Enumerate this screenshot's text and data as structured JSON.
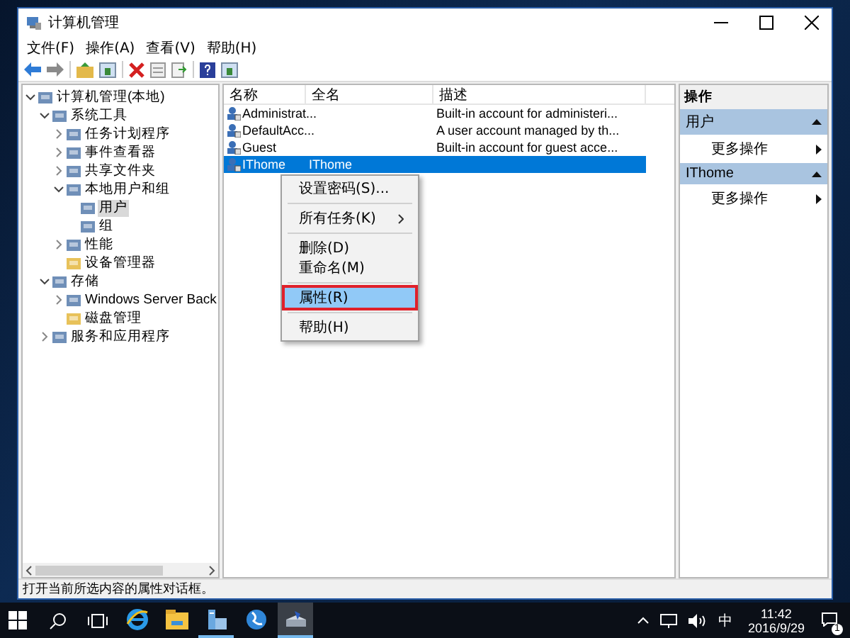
{
  "window": {
    "title": "计算机管理"
  },
  "menu": [
    "文件(F)",
    "操作(A)",
    "查看(V)",
    "帮助(H)"
  ],
  "tree": [
    {
      "label": "计算机管理(本地)",
      "expanded": true,
      "selected": false,
      "children": [
        {
          "label": "系统工具",
          "expanded": true,
          "selected": false,
          "children": [
            {
              "label": "任务计划程序",
              "expanded": false,
              "selected": false
            },
            {
              "label": "事件查看器",
              "expanded": false,
              "selected": false
            },
            {
              "label": "共享文件夹",
              "expanded": false,
              "selected": false
            },
            {
              "label": "本地用户和组",
              "expanded": true,
              "selected": false,
              "children": [
                {
                  "label": "用户",
                  "selected": true
                },
                {
                  "label": "组",
                  "selected": false
                }
              ]
            },
            {
              "label": "性能",
              "expanded": false,
              "selected": false
            },
            {
              "label": "设备管理器",
              "selected": false
            }
          ]
        },
        {
          "label": "存储",
          "expanded": true,
          "selected": false,
          "children": [
            {
              "label": "Windows Server Back",
              "expanded": false,
              "selected": false
            },
            {
              "label": "磁盘管理",
              "selected": false
            }
          ]
        },
        {
          "label": "服务和应用程序",
          "expanded": false,
          "selected": false
        }
      ]
    }
  ],
  "table": {
    "columns": [
      "名称",
      "全名",
      "描述"
    ],
    "rows": [
      {
        "name": "Administrat...",
        "full_name": "",
        "description": "Built-in account for administeri...",
        "selected": false
      },
      {
        "name": "DefaultAcc...",
        "full_name": "",
        "description": "A user account managed by th...",
        "selected": false
      },
      {
        "name": "Guest",
        "full_name": "",
        "description": "Built-in account for guest acce...",
        "selected": false
      },
      {
        "name": "IThome",
        "full_name": "IThome",
        "description": "",
        "selected": true
      }
    ]
  },
  "context_menu": [
    {
      "kind": "item",
      "label": "设置密码(S)...",
      "submenu": false,
      "highlighted": false
    },
    {
      "kind": "separator"
    },
    {
      "kind": "item",
      "label": "所有任务(K)",
      "submenu": true,
      "highlighted": false
    },
    {
      "kind": "separator"
    },
    {
      "kind": "item",
      "label": "删除(D)",
      "submenu": false,
      "highlighted": false
    },
    {
      "kind": "item",
      "label": "重命名(M)",
      "submenu": false,
      "highlighted": false
    },
    {
      "kind": "separator"
    },
    {
      "kind": "item",
      "label": "属性(R)",
      "submenu": false,
      "highlighted": true
    },
    {
      "kind": "separator"
    },
    {
      "kind": "item",
      "label": "帮助(H)",
      "submenu": false,
      "highlighted": false
    }
  ],
  "actions": {
    "title": "操作",
    "sections": [
      {
        "title": "用户",
        "items": [
          "更多操作"
        ]
      },
      {
        "title": "IThome",
        "items": [
          "更多操作"
        ]
      }
    ]
  },
  "status_bar": "打开当前所选内容的属性对话框。",
  "taskbar": {
    "apps": [
      {
        "kind": "ie",
        "running": false,
        "active": false
      },
      {
        "kind": "explorer",
        "running": false,
        "active": false
      },
      {
        "kind": "server",
        "running": true,
        "active": false
      },
      {
        "kind": "globe",
        "running": false,
        "active": false
      },
      {
        "kind": "mmc",
        "running": true,
        "active": true
      }
    ],
    "ime": "中",
    "time": "11:42",
    "date": "2016/9/29",
    "notifications": "1"
  }
}
